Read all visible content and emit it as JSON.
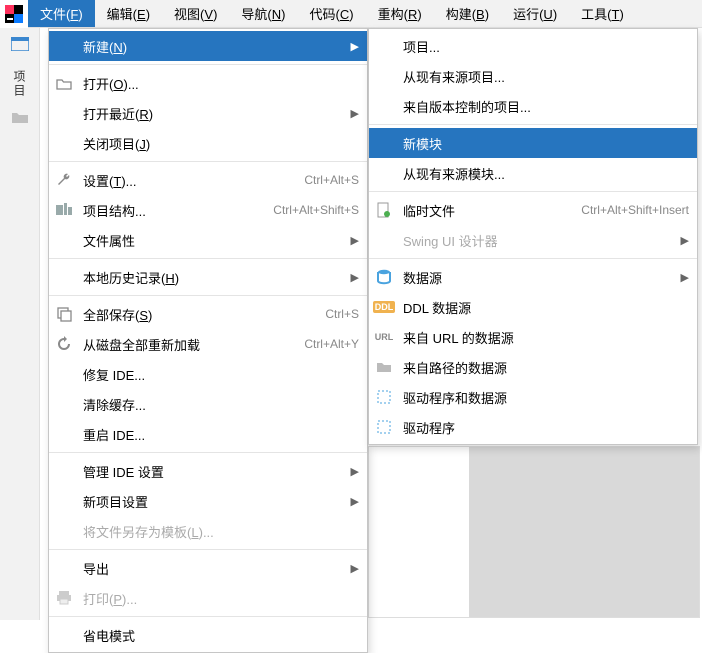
{
  "menubar": {
    "items": [
      {
        "label": "文件",
        "mn": "F"
      },
      {
        "label": "编辑",
        "mn": "E"
      },
      {
        "label": "视图",
        "mn": "V"
      },
      {
        "label": "导航",
        "mn": "N"
      },
      {
        "label": "代码",
        "mn": "C"
      },
      {
        "label": "重构",
        "mn": "R"
      },
      {
        "label": "构建",
        "mn": "B"
      },
      {
        "label": "运行",
        "mn": "U"
      },
      {
        "label": "工具",
        "mn": "T"
      }
    ]
  },
  "left_strip": {
    "project_label": "项目"
  },
  "file_menu": {
    "new": {
      "label": "新建",
      "mn": "N"
    },
    "open": {
      "label": "打开",
      "mn": "O",
      "suffix": "..."
    },
    "open_recent": {
      "label": "打开最近",
      "mn": "R"
    },
    "close_project": {
      "label": "关闭项目",
      "mn": "J"
    },
    "settings": {
      "label": "设置",
      "mn": "T",
      "suffix": "...",
      "shortcut": "Ctrl+Alt+S"
    },
    "project_structure": {
      "label": "项目结构...",
      "shortcut": "Ctrl+Alt+Shift+S"
    },
    "file_properties": {
      "label": "文件属性"
    },
    "local_history": {
      "label": "本地历史记录",
      "mn": "H"
    },
    "save_all": {
      "label": "全部保存",
      "mn": "S",
      "shortcut": "Ctrl+S"
    },
    "reload_from_disk": {
      "label": "从磁盘全部重新加载",
      "shortcut": "Ctrl+Alt+Y"
    },
    "repair_ide": {
      "label": "修复 IDE..."
    },
    "clear_cache": {
      "label": "清除缓存..."
    },
    "restart_ide": {
      "label": "重启 IDE..."
    },
    "manage_ide_settings": {
      "label": "管理 IDE 设置"
    },
    "new_project_settings": {
      "label": "新项目设置"
    },
    "save_as_template": {
      "label": "将文件另存为模板",
      "mn": "L",
      "suffix": "..."
    },
    "export": {
      "label": "导出"
    },
    "print": {
      "label": "打印",
      "mn": "P",
      "suffix": "..."
    },
    "power_save": {
      "label": "省电模式"
    }
  },
  "new_submenu": {
    "project": {
      "label": "项目..."
    },
    "project_from_existing": {
      "label": "从现有来源项目..."
    },
    "project_from_vcs": {
      "label": "来自版本控制的项目..."
    },
    "new_module": {
      "label": "新模块"
    },
    "module_from_existing": {
      "label": "从现有来源模块..."
    },
    "scratch_file": {
      "label": "临时文件",
      "shortcut": "Ctrl+Alt+Shift+Insert"
    },
    "swing_ui_designer": {
      "label": "Swing UI 设计器"
    },
    "data_source": {
      "label": "数据源"
    },
    "ddl_data_source": {
      "label": "DDL 数据源"
    },
    "data_source_from_url": {
      "label": "来自 URL 的数据源"
    },
    "data_source_from_path": {
      "label": "来自路径的数据源"
    },
    "driver_and_data_source": {
      "label": "驱动程序和数据源"
    },
    "driver": {
      "label": "驱动程序"
    }
  }
}
